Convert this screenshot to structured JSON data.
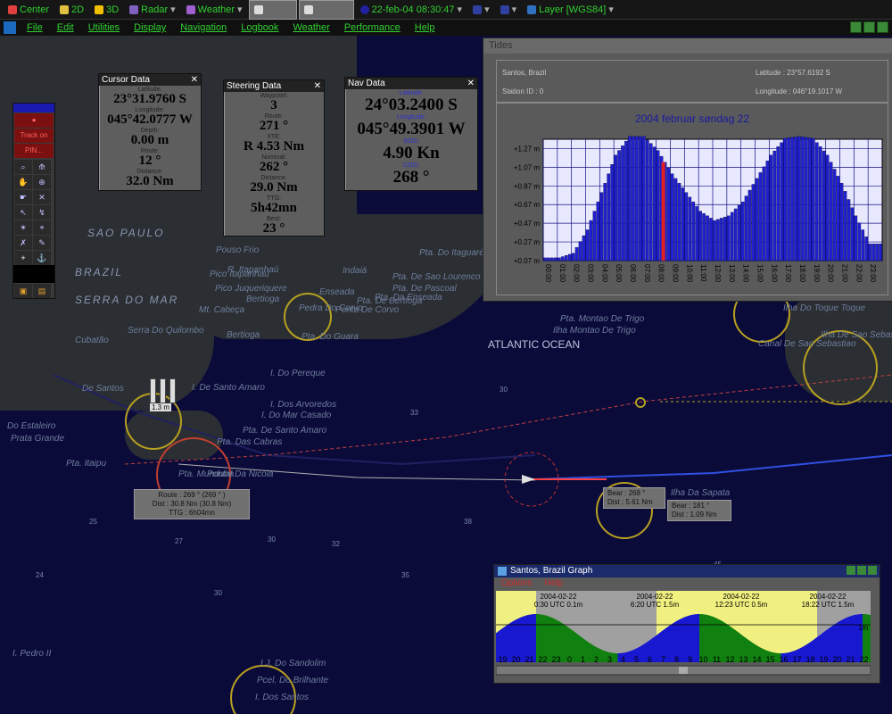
{
  "toolbar": {
    "buttons": [
      {
        "label": "Center",
        "icon": "pencil-icon"
      },
      {
        "label": "2D",
        "icon": "pencil-icon"
      },
      {
        "label": "3D",
        "icon": "warning-icon"
      },
      {
        "label": "Radar",
        "icon": "radar-icon"
      },
      {
        "label": "Weather",
        "icon": "weather-icon"
      },
      {
        "label": "",
        "icon": "tide-icon"
      },
      {
        "label": "",
        "icon": "pencil-icon"
      },
      {
        "label": "22-feb-04 08:30:47",
        "icon": "clock-icon"
      },
      {
        "label": "",
        "icon": "zoom-in-icon"
      },
      {
        "label": "",
        "icon": "zoom-out-icon"
      },
      {
        "label": "Layer [WGS84]",
        "icon": "layer-icon"
      }
    ]
  },
  "menubar": {
    "items": [
      "File",
      "Edit",
      "Utilities",
      "Display",
      "Navigation",
      "Logbook",
      "Weather",
      "Performance",
      "Help"
    ]
  },
  "cursor_data": {
    "title": "Cursor Data",
    "latitude_label": "Latitude:",
    "latitude": "23°31.9760 S",
    "longitude_label": "Longitude:",
    "longitude": "045°42.0777 W",
    "depth_label": "Depth:",
    "depth": "0.00 m",
    "route_label": "Route:",
    "route": "12 °",
    "distance_label": "Distance:",
    "distance": "32.0 Nm"
  },
  "steering_data": {
    "title": "Steering Data",
    "waypoint_label": "Waypoint:",
    "waypoint": "3",
    "route_label": "Route:",
    "route": "271 °",
    "xte_label": "XTE:",
    "xte": "R 4.53 Nm",
    "nominal_label": "Nominal:",
    "nominal": "262 °",
    "distance_label": "Distance:",
    "distance": "29.0 Nm",
    "ttg_label": "TTG:",
    "ttg": "5h42mn",
    "best_label": "Best:",
    "best": "23 °"
  },
  "nav_data": {
    "title": "Nav Data",
    "latitude_label": "Latitude:",
    "latitude": "24°03.2400 S",
    "longitude_label": "Longitude:",
    "longitude": "045°49.3901 W",
    "sog_label": "SOG:",
    "sog": "4.90 Kn",
    "cog_label": "COG:",
    "cog": "268 °"
  },
  "tool_panel": {
    "track_on": "Track on",
    "pin_label": "PIN..."
  },
  "map_labels": {
    "sao_paulo": "SAO PAULO",
    "brazil": "BRAZIL",
    "serra": "SERRA DO MAR",
    "ocean": "ATLANTIC OCEAN",
    "small": [
      "Pouso Frio",
      "R. Itapanhaú",
      "Pico Juqueriquere",
      "Pico Itapanhaú",
      "Mt. Cabeça",
      "Serra Do Quilombo",
      "Bertioga",
      "Bertioga",
      "Pta. Do Guara",
      "Pta. De Sao Lourenco",
      "Pta. Do Itaguaré",
      "Pta. De Pascoal",
      "Pta. Da Enseada",
      "Pta. De Bertioga",
      "Ponta De Corvo",
      "Enseada",
      "Indaiá",
      "Pedra Do Corvo",
      "De Santos",
      "Prata Grande",
      "Pta. Itaipu",
      "Pta. Munduba",
      "I. Do Pereque",
      "I. Dos Arvoredos",
      "I. Do Mar Casado",
      "Pta. De Santo Amaro",
      "Pta. Das Cabras",
      "I. De Santo Amaro",
      "Pontal Da Nicola",
      "Pta. Montao De Trigo",
      "Ilha Montao De Trigo",
      "Ilha Do Toque Toque",
      "Canal De Sao Sebastiao",
      "Ilha De Sao Sebastiao",
      "Ilha Da Sapata",
      "I. Pedro II",
      "I.J. Do Sandolim",
      "Pcel. Do Brilhante",
      "I. Dos Santos",
      "Do Estaleiro",
      "Cubatão"
    ]
  },
  "route_box": {
    "route": "Route : 269 ° (269 ° )",
    "dist": "Dist : 30.8 Nm (30.8 Nm)",
    "ttg": "TTG : 6h04mn"
  },
  "bear_box_1": {
    "bear": "Bear : 268 °",
    "dist": "Dist : 5.61 Nm"
  },
  "bear_box_2": {
    "bear": "Bear : 181 °",
    "dist": "Dist : 1.09 Nm"
  },
  "scale_label": "1.3 m",
  "tides": {
    "title": "Tides",
    "station": "Santos, Brazil",
    "station_id": "Station ID : 0",
    "latitude": "Latitude : 23°57.6192 S",
    "longitude": "Longitude : 046°19.1017 W"
  },
  "chart_data": [
    {
      "type": "bar",
      "title": "2004 februar søndag 22",
      "yticklabels": [
        "+0.07 m",
        "+0.27 m",
        "+0.47 m",
        "+0.67 m",
        "+0.87 m",
        "+1.07 m",
        "+1.27 m"
      ],
      "categories": [
        "00:00",
        "01:00",
        "02:00",
        "03:00",
        "04:00",
        "05:00",
        "06:00",
        "07:00",
        "08:00",
        "09:00",
        "10:00",
        "11:00",
        "12:00",
        "13:00",
        "14:00",
        "15:00",
        "16:00",
        "17:00",
        "18:00",
        "19:00",
        "20:00",
        "21:00",
        "22:00",
        "23:00"
      ],
      "ylim": [
        0.07,
        1.37
      ],
      "series": [
        {
          "values": [
            0.1,
            0.1,
            0.15,
            0.4,
            0.8,
            1.2,
            1.4,
            1.4,
            1.25,
            1.0,
            0.8,
            0.6,
            0.5,
            0.55,
            0.7,
            0.95,
            1.2,
            1.38,
            1.4,
            1.38,
            1.2,
            0.9,
            0.55,
            0.25
          ]
        }
      ],
      "current_time": "08:30",
      "colors": {
        "bars": "#2020d0",
        "current": "#e02020",
        "grid": "#101080"
      }
    },
    {
      "type": "area",
      "title": "Santos, Brazil Graph",
      "events": [
        {
          "date": "2004-02-22",
          "text": "0:30 UTC 0.1m"
        },
        {
          "date": "2004-02-22",
          "text": "6:20 UTC 1.5m"
        },
        {
          "date": "2004-02-22",
          "text": "12:23 UTC 0.5m"
        },
        {
          "date": "2004-02-22",
          "text": "18:22 UTC 1.5m"
        }
      ],
      "right_label": "1m",
      "hour_labels": [
        "19",
        "20",
        "21",
        "22",
        "23",
        "0",
        "1",
        "2",
        "3",
        "4",
        "5",
        "6",
        "7",
        "8",
        "9",
        "10",
        "11",
        "12",
        "13",
        "14",
        "15",
        "16",
        "17",
        "18",
        "19",
        "20",
        "21",
        "22"
      ],
      "colors": {
        "rising": "#1818d0",
        "falling": "#108010",
        "day": "#f0f080",
        "night": "#a0a0a0"
      }
    }
  ],
  "graph_window": {
    "title": "Santos, Brazil Graph",
    "menu": [
      "Options",
      "Help"
    ]
  }
}
